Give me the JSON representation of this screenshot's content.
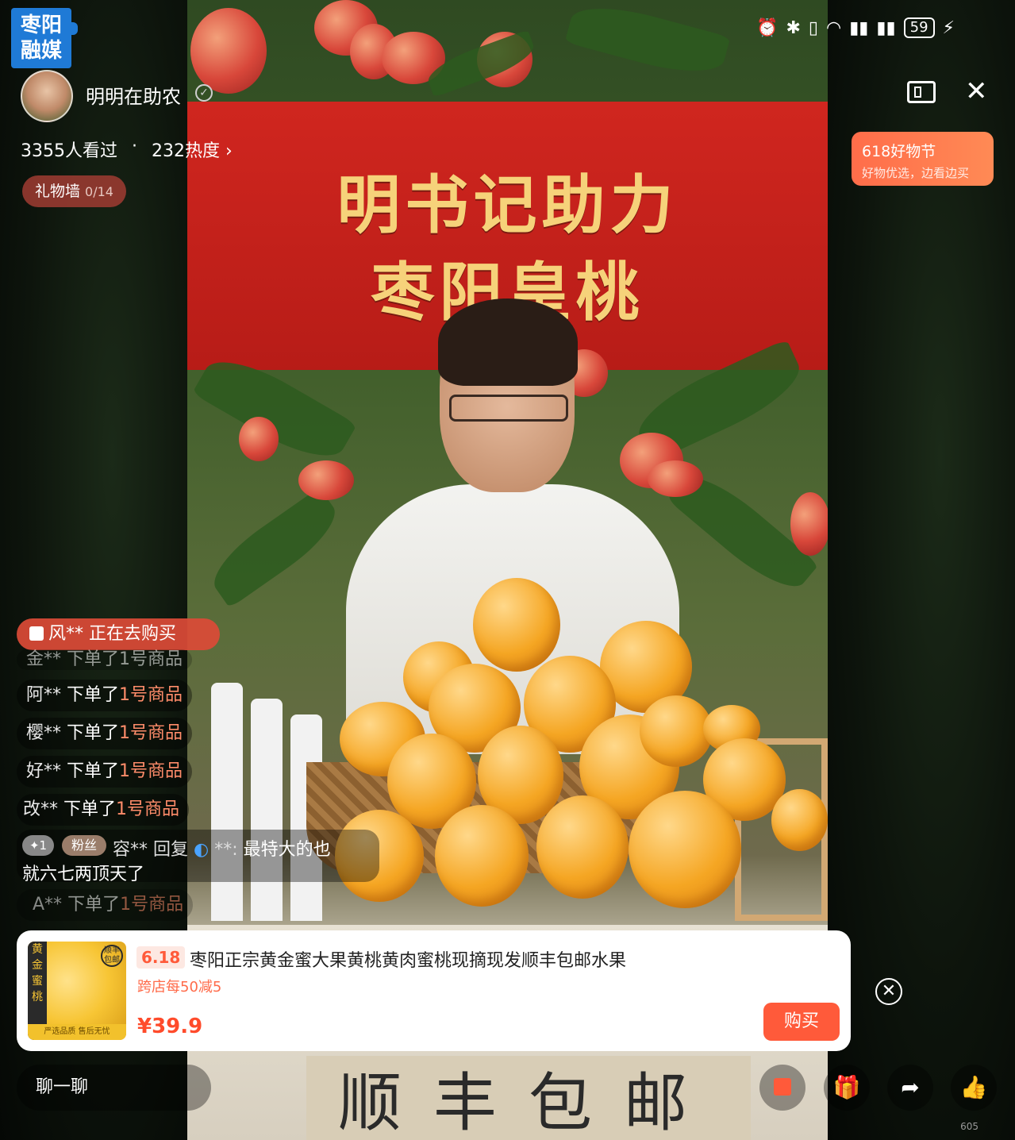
{
  "logo": {
    "line1": "枣阳",
    "line2": "融媒"
  },
  "status_bar": {
    "battery": "59"
  },
  "host": {
    "name": "明明在助农"
  },
  "stats": {
    "viewers": "3355人看过",
    "dot": "·",
    "heat": "232热度 ›"
  },
  "gift_wall": {
    "label": "礼物墙",
    "count": "0/14"
  },
  "promo": {
    "title": "618好物节",
    "subtitle": "好物优选，边看边买"
  },
  "video": {
    "banner_line1": "明书记助力",
    "banner_line2": "枣阳皇桃",
    "sign": "顺丰包邮"
  },
  "feed": {
    "buying": "风** 正在去购买",
    "faded_top": "金** 下单了1号商品",
    "items": [
      {
        "who": "阿**",
        "action": "下单了",
        "item": "1号商品"
      },
      {
        "who": "樱**",
        "action": "下单了",
        "item": "1号商品"
      },
      {
        "who": "好**",
        "action": "下单了",
        "item": "1号商品"
      },
      {
        "who": "改**",
        "action": "下单了",
        "item": "1号商品"
      }
    ],
    "reply": {
      "level": "✦1",
      "fan_badge": "粉丝",
      "who": "容**",
      "verb": "回复",
      "target": "**:",
      "text_line1": "最特大的也",
      "text_line2": "就六七两顶天了"
    },
    "last": {
      "who": "A**",
      "action": "下单了",
      "item": "1号商品"
    }
  },
  "product": {
    "badge": "6.18",
    "title": "枣阳正宗黄金蜜大果黄桃黄肉蜜桃现摘现发顺丰包邮水果",
    "promo": "跨店每50减5",
    "price": "¥39.9",
    "buy": "购买",
    "img_strip": "黄金蜜桃",
    "img_tag": "顺丰包邮",
    "img_bottom": "严选品质 售后无忧"
  },
  "bottom": {
    "chat_placeholder": "聊一聊"
  },
  "version": "605"
}
